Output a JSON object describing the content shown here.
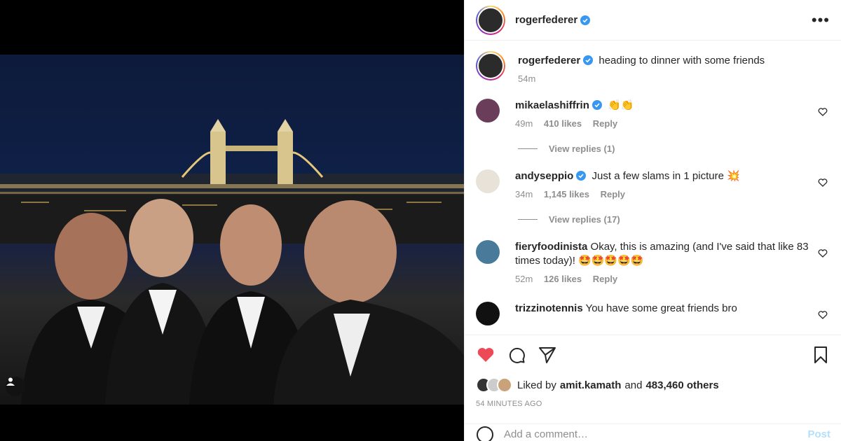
{
  "post": {
    "author": "rogerfederer",
    "author_verified": true,
    "caption": "heading to dinner with some friends",
    "caption_time": "54m"
  },
  "header": {
    "username": "rogerfederer",
    "more_label": "•••"
  },
  "comments": [
    {
      "username": "mikaelashiffrin",
      "verified": true,
      "text": "👏👏",
      "time": "49m",
      "likes": "410 likes",
      "reply_label": "Reply",
      "view_replies": "View replies (1)"
    },
    {
      "username": "andyseppio",
      "verified": true,
      "text": "Just a few slams in 1 picture 💥",
      "time": "34m",
      "likes": "1,145 likes",
      "reply_label": "Reply",
      "view_replies": "View replies (17)"
    },
    {
      "username": "fieryfoodinista",
      "verified": false,
      "text": "Okay, this is amazing (and I've said that like 83 times today)! 🤩🤩🤩🤩🤩",
      "time": "52m",
      "likes": "126 likes",
      "reply_label": "Reply"
    },
    {
      "username": "trizzinotennis",
      "verified": false,
      "text": "You have some great friends bro"
    }
  ],
  "likes_summary": {
    "prefix": "Liked by",
    "user": "amit.kamath",
    "and": "and",
    "others": "483,460 others"
  },
  "timestamp": "54 MINUTES AGO",
  "add_comment": {
    "placeholder": "Add a comment…",
    "post_label": "Post"
  },
  "colors": {
    "heart_active": "#ed4956",
    "verified_blue": "#3897f0",
    "muted_text": "#8e8e8e"
  },
  "icons": [
    "heart-icon",
    "comment-icon",
    "share-icon",
    "bookmark-icon",
    "more-options-icon",
    "tagged-user-icon",
    "verified-badge-icon"
  ]
}
